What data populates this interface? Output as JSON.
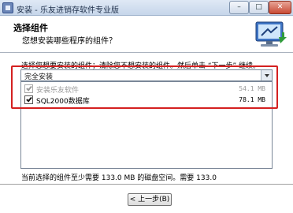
{
  "window": {
    "title": "安装 - 乐友进销存软件专业版",
    "minimize_glyph": "–",
    "maximize_glyph": "□",
    "close_glyph": "✕"
  },
  "header": {
    "title": "选择组件",
    "subtitle": "您想安装哪些程序的组件？",
    "image_icon": "computer-install-icon"
  },
  "components": {
    "instruction": "选择您想要安装的组件；清除您不想安装的组件。然后单击 “下一步” 继续。",
    "type_select": {
      "value": "完全安装"
    },
    "items": [
      {
        "label": "安装乐友软件",
        "size": "54.1 MB",
        "checked": true,
        "disabled": true
      },
      {
        "label": "SQL2000数据库",
        "size": "78.1 MB",
        "checked": true,
        "disabled": false
      }
    ]
  },
  "footer": {
    "requirement_text": "当前选择的组件至少需要 133.0 MB 的磁盘空间。需要 133.0",
    "back_button": "< 上一步(B)"
  },
  "colors": {
    "highlight_border": "#d42020",
    "title_bar": "#c6d6ea"
  }
}
